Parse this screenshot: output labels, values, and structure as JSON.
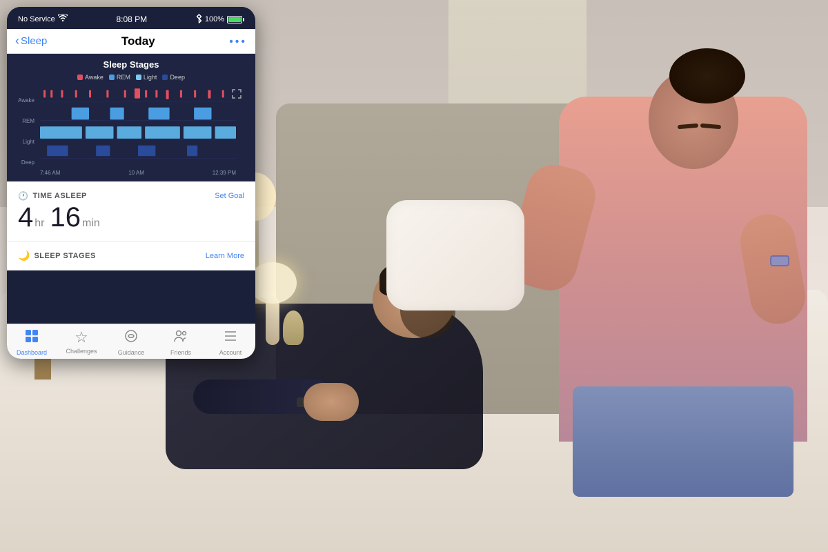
{
  "statusBar": {
    "signal": "No Service",
    "wifi": "wifi",
    "time": "8:08 PM",
    "bluetooth": "bluetooth",
    "battery": "100%",
    "batteryIcon": "battery"
  },
  "nav": {
    "backLabel": "Sleep",
    "title": "Today",
    "moreIcon": "..."
  },
  "chart": {
    "title": "Sleep Stages",
    "expandIcon": "⤢",
    "legend": [
      {
        "label": "Awake",
        "color": "#e05060"
      },
      {
        "label": "REM",
        "color": "#4a9de0"
      },
      {
        "label": "Light",
        "color": "#7ec8f0"
      },
      {
        "label": "Deep",
        "color": "#2a4a9a"
      }
    ],
    "yLabels": [
      "Awake",
      "REM",
      "Light",
      "Deep"
    ],
    "xLabels": [
      "7:46 AM",
      "10 AM",
      "12:39 PM"
    ]
  },
  "timeAsleep": {
    "label": "TIME ASLEEP",
    "actionLabel": "Set Goal",
    "hours": "4",
    "hrUnit": "hr",
    "minutes": "16",
    "minUnit": "min"
  },
  "sleepStages": {
    "label": "SLEEP STAGES",
    "actionLabel": "Learn More"
  },
  "tabBar": {
    "tabs": [
      {
        "label": "Dashboard",
        "icon": "⊞",
        "active": true
      },
      {
        "label": "Challenges",
        "icon": "☆",
        "active": false
      },
      {
        "label": "Guidance",
        "icon": "✿",
        "active": false
      },
      {
        "label": "Friends",
        "icon": "👤",
        "active": false
      },
      {
        "label": "Account",
        "icon": "☰",
        "active": false
      }
    ]
  }
}
